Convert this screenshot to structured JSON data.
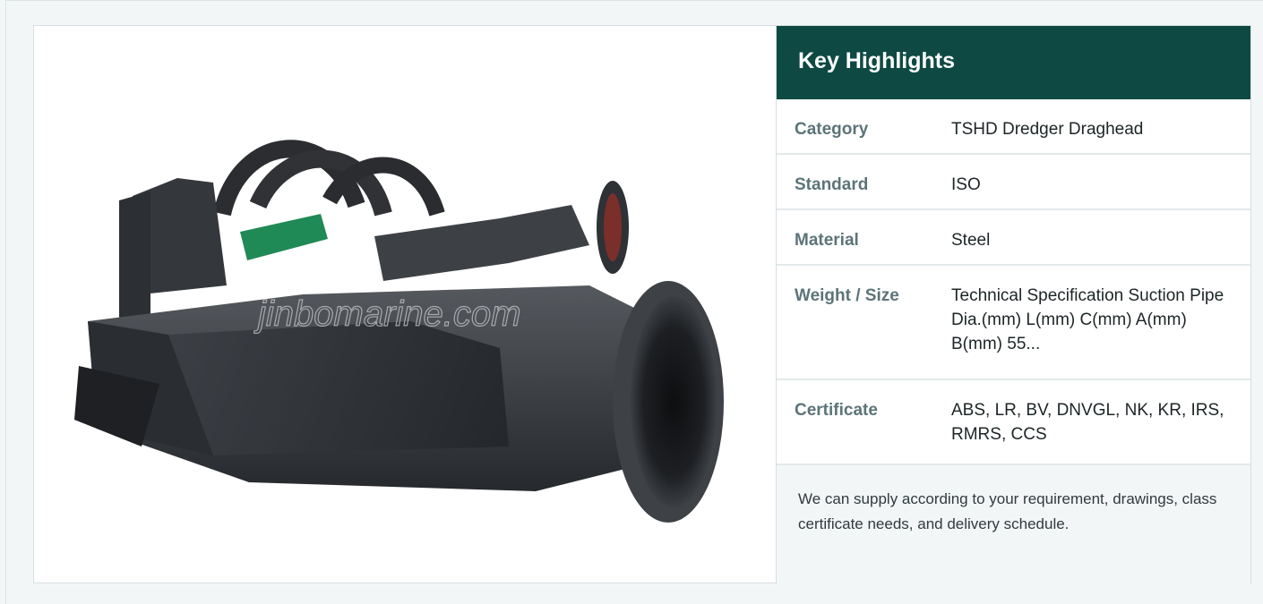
{
  "product_image": {
    "alt": "TSHD Dredger Draghead",
    "watermark": "jinbomarine.com"
  },
  "highlights": {
    "title": "Key Highlights",
    "rows": [
      {
        "label": "Category",
        "value": "TSHD Dredger Draghead"
      },
      {
        "label": "Standard",
        "value": "ISO"
      },
      {
        "label": "Material",
        "value": "Steel"
      },
      {
        "label": "Weight / Size",
        "value": "Technical Specification Suction Pipe Dia.(mm) L(mm) C(mm) A(mm) B(mm) 55..."
      },
      {
        "label": "Certificate",
        "value": "ABS, LR, BV, DNVGL, NK, KR, IRS, RMRS, CCS"
      }
    ],
    "note": "We can supply according to your requirement, drawings, class certificate needs, and delivery schedule."
  },
  "colors": {
    "header_bg": "#0e4a43",
    "label_text": "#5c7479",
    "note_bg": "#f3f6f7"
  }
}
